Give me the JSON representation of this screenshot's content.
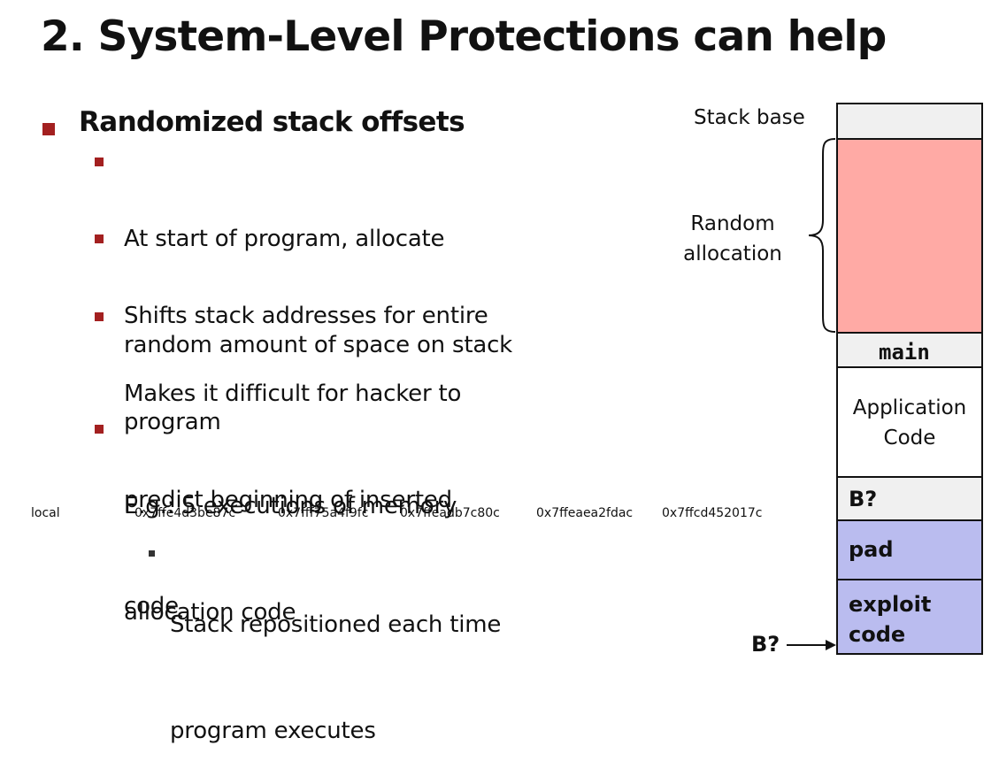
{
  "title": "2. System-Level Protections can help",
  "bullet": {
    "heading": "Randomized stack offsets",
    "items": [
      {
        "lines": [
          "At start of program, allocate",
          "random amount of space on stack"
        ]
      },
      {
        "lines": [
          "Shifts stack addresses for entire",
          "program"
        ]
      },
      {
        "lines": [
          "Makes it difficult for hacker to",
          "predict beginning of inserted",
          "code"
        ]
      },
      {
        "lines": [
          "E.g.: 5 executions of memory",
          "allocation code"
        ]
      }
    ],
    "addresses": {
      "label": "local",
      "values": [
        "0x7ffe4d3be87c",
        "0x7fff75a4f9fc",
        "0x7ffeadb7c80c",
        "0x7ffeaea2fdac",
        "0x7ffcd452017c"
      ]
    },
    "sub_item": {
      "lines": [
        "Stack repositioned each time",
        "program executes"
      ]
    }
  },
  "diagram": {
    "stack_base_label": "Stack base",
    "random_allocation_label": [
      "Random",
      "allocation"
    ],
    "main_label": "main",
    "app_code_label": [
      "Application",
      "Code"
    ],
    "b_label": "B?",
    "pad_label": "pad",
    "exploit_label": [
      "exploit",
      "code"
    ],
    "pointer_label": "B?",
    "colors": {
      "random_fill": "#ffaaa5",
      "stack_fill": "#f0f0f0",
      "exploit_fill": "#babcef",
      "bullet": "#a32020"
    }
  }
}
